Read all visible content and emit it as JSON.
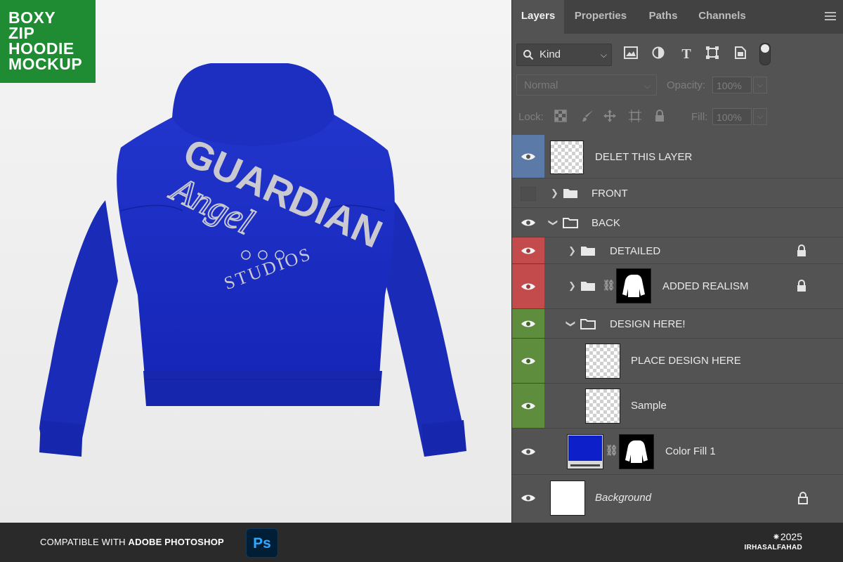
{
  "badge": {
    "lines": [
      "BOXY",
      "ZIP",
      "HOODIE",
      "MOCKUP"
    ],
    "color": "#1f8b32"
  },
  "artwork": {
    "garment_color": "#1a2ec4",
    "print_color": "#c9c9cf",
    "print_lines": [
      "GUARDIAN",
      "Angel",
      "STUDIOS"
    ]
  },
  "panel": {
    "tabs": [
      "Layers",
      "Properties",
      "Paths",
      "Channels"
    ],
    "active_tab": "Layers",
    "filter": {
      "label": "Kind"
    },
    "blend_mode": "Normal",
    "opacity_label": "Opacity:",
    "opacity_value": "100%",
    "lock_label": "Lock:",
    "fill_label": "Fill:",
    "fill_value": "100%",
    "layers": [
      {
        "name": "DELET THIS LAYER",
        "eye_color": "#5b7aa8"
      },
      {
        "name": "FRONT"
      },
      {
        "name": "BACK"
      },
      {
        "name": "DETAILED",
        "eye_color": "#c44b4b"
      },
      {
        "name": "ADDED REALISM",
        "eye_color": "#c44b4b"
      },
      {
        "name": "DESIGN HERE!",
        "eye_color": "#5e8d3e"
      },
      {
        "name": "PLACE DESIGN HERE",
        "eye_color": "#5e8d3e"
      },
      {
        "name": "Sample",
        "eye_color": "#5e8d3e"
      },
      {
        "name": "Color Fill 1",
        "fill_swatch": "#0c1fc9"
      },
      {
        "name": "Background"
      }
    ]
  },
  "footer": {
    "compat_prefix": "COMPATIBLE WITH ",
    "compat_app": "ADOBE PHOTOSHOP",
    "ps_logo": "Ps",
    "year": "⁕2025",
    "author": "IRHASALFAHAD"
  }
}
